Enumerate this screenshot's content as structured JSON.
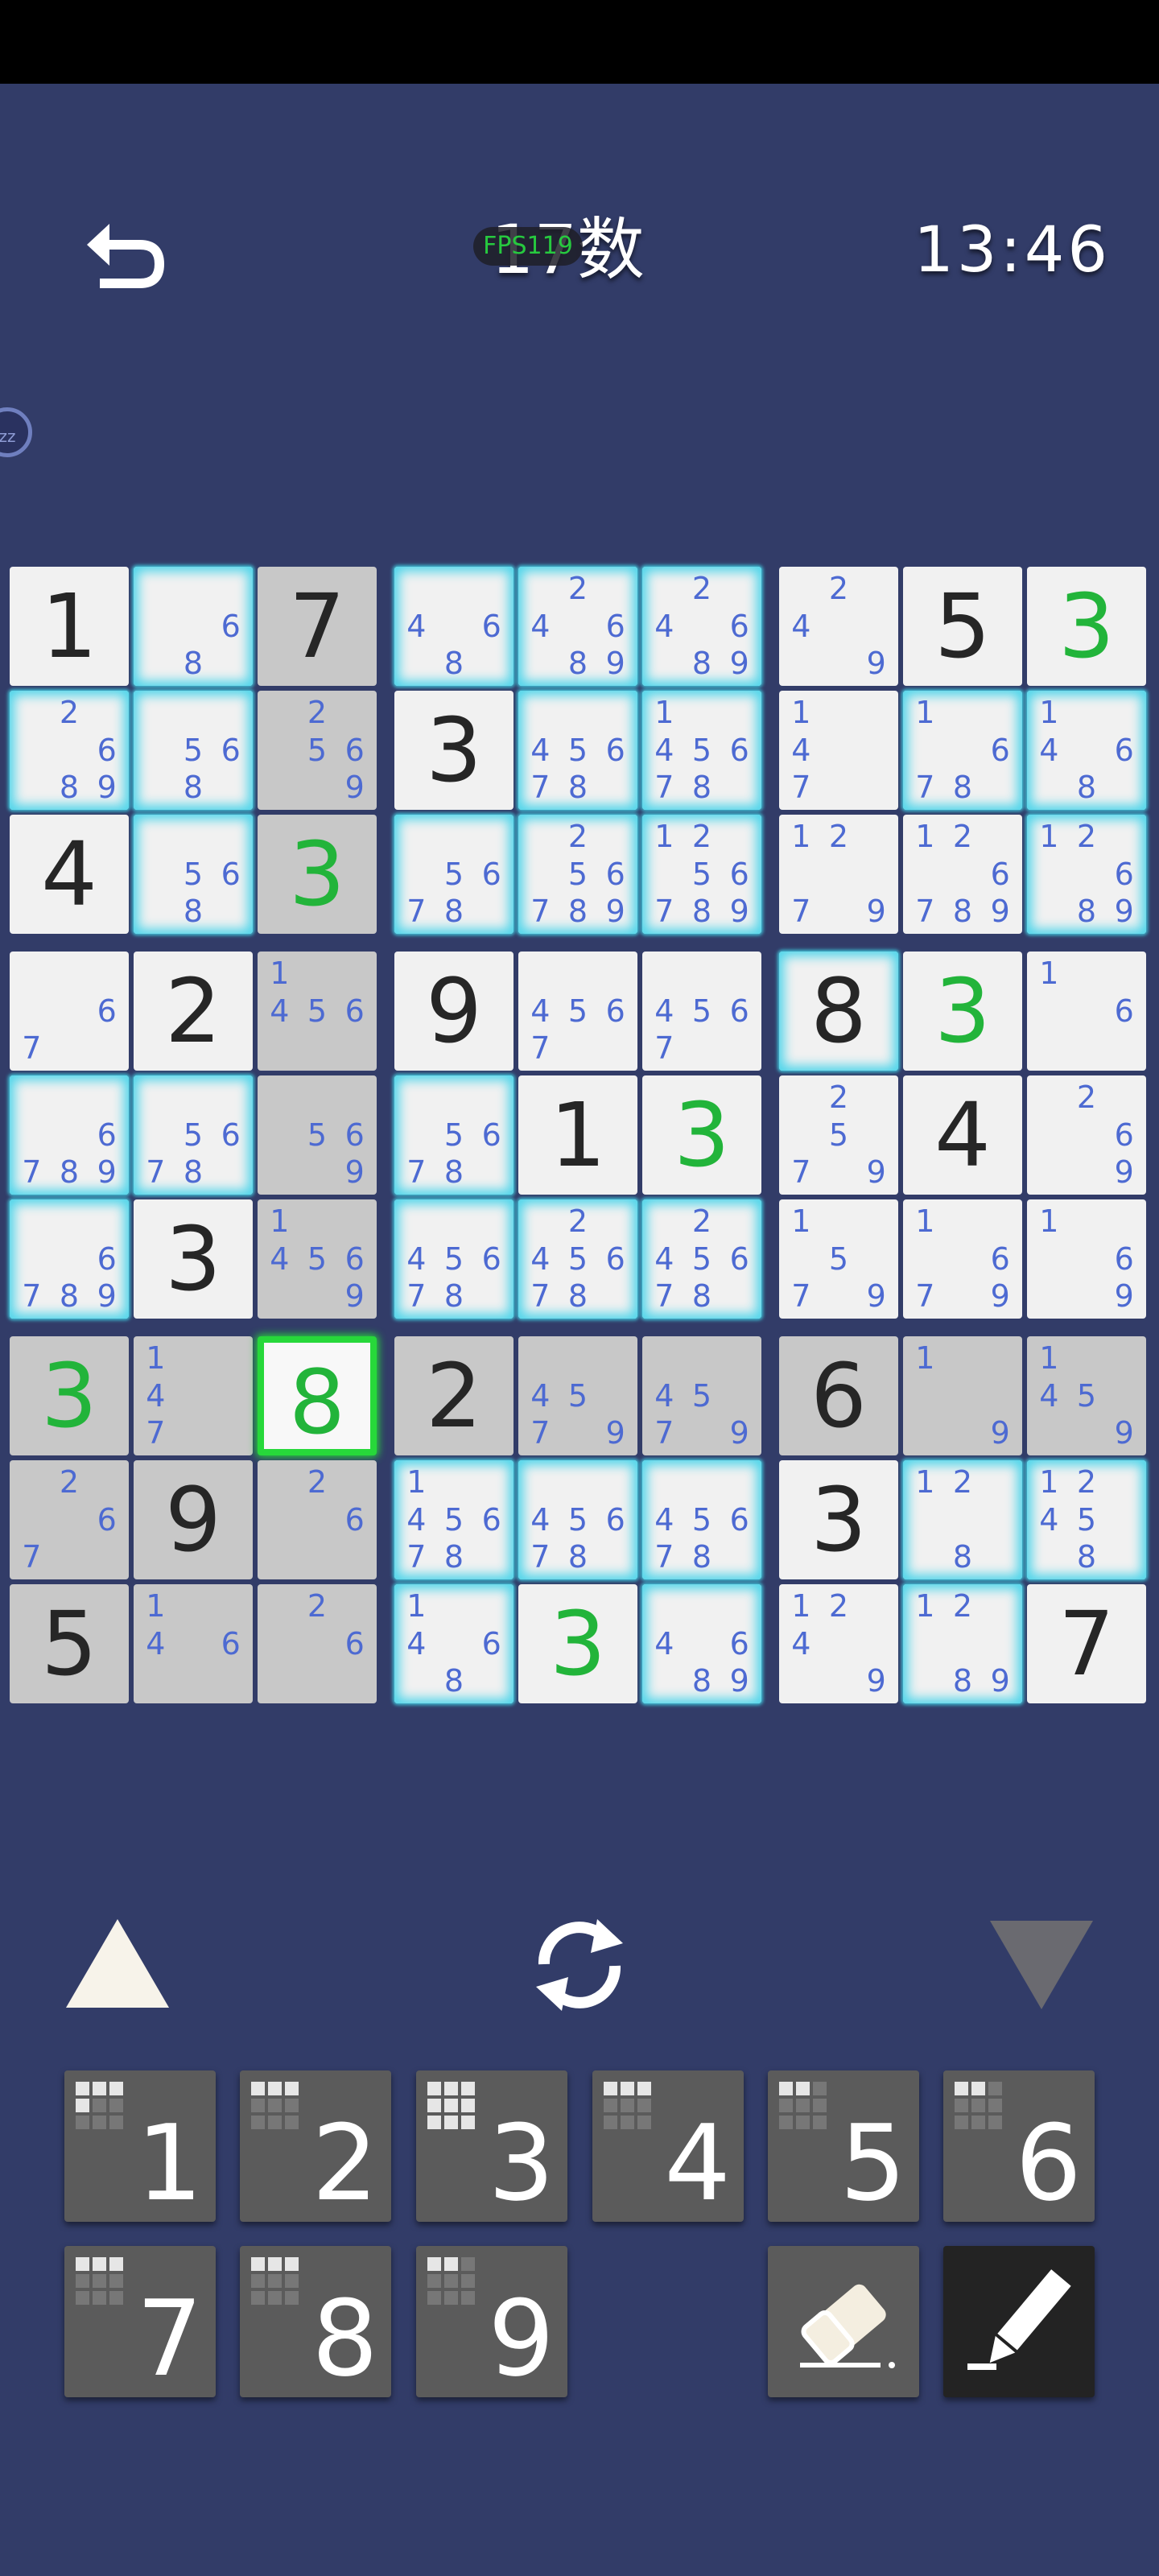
{
  "header": {
    "title": "17数",
    "fps_label": "FPS119",
    "timer": "13:46",
    "pause_label": "zz"
  },
  "colors": {
    "background": "#323c68",
    "given_digit": "#262626",
    "placed_digit": "#22b43a",
    "note_digit": "#4d6ad2",
    "highlight_glow": "#4fd5ea",
    "selected_border": "#27d83a"
  },
  "board": {
    "selected": [
      6,
      2
    ],
    "rows": [
      [
        {
          "v": "1",
          "k": "given",
          "s": "white"
        },
        {
          "n": [
            "6",
            "8"
          ],
          "s": "hl"
        },
        {
          "v": "7",
          "k": "given",
          "s": "gray"
        },
        {
          "n": [
            "4",
            "6",
            "8"
          ],
          "s": "hl"
        },
        {
          "n": [
            "2",
            "4",
            "6",
            "8",
            "9"
          ],
          "s": "hl"
        },
        {
          "n": [
            "2",
            "4",
            "6",
            "8",
            "9"
          ],
          "s": "hl"
        },
        {
          "n": [
            "2",
            "4",
            "9"
          ],
          "s": "white"
        },
        {
          "v": "5",
          "k": "given",
          "s": "white"
        },
        {
          "v": "3",
          "k": "placed",
          "s": "white"
        }
      ],
      [
        {
          "n": [
            "2",
            "6",
            "8",
            "9"
          ],
          "s": "hl"
        },
        {
          "n": [
            "5",
            "6",
            "8"
          ],
          "s": "hl"
        },
        {
          "n": [
            "2",
            "5",
            "6",
            "9"
          ],
          "s": "gray"
        },
        {
          "v": "3",
          "k": "given",
          "s": "white"
        },
        {
          "n": [
            "4",
            "5",
            "6",
            "7",
            "8"
          ],
          "s": "hl"
        },
        {
          "n": [
            "1",
            "4",
            "5",
            "6",
            "7",
            "8"
          ],
          "s": "hl"
        },
        {
          "n": [
            "1",
            "4",
            "7"
          ],
          "s": "white"
        },
        {
          "n": [
            "1",
            "6",
            "7",
            "8"
          ],
          "s": "hl"
        },
        {
          "n": [
            "1",
            "4",
            "6",
            "8"
          ],
          "s": "hl"
        }
      ],
      [
        {
          "v": "4",
          "k": "given",
          "s": "white"
        },
        {
          "n": [
            "5",
            "6",
            "8"
          ],
          "s": "hl"
        },
        {
          "v": "3",
          "k": "placed",
          "s": "gray"
        },
        {
          "n": [
            "5",
            "6",
            "7",
            "8"
          ],
          "s": "hl"
        },
        {
          "n": [
            "2",
            "5",
            "6",
            "7",
            "8",
            "9"
          ],
          "s": "hl"
        },
        {
          "n": [
            "1",
            "2",
            "5",
            "6",
            "7",
            "8",
            "9"
          ],
          "s": "hl"
        },
        {
          "n": [
            "1",
            "2",
            "7",
            "9"
          ],
          "s": "white"
        },
        {
          "n": [
            "1",
            "2",
            "6",
            "7",
            "8",
            "9"
          ],
          "s": "white"
        },
        {
          "n": [
            "1",
            "2",
            "6",
            "8",
            "9"
          ],
          "s": "hl"
        }
      ],
      [
        {
          "n": [
            "6",
            "7"
          ],
          "s": "white"
        },
        {
          "v": "2",
          "k": "given",
          "s": "white"
        },
        {
          "n": [
            "1",
            "4",
            "5",
            "6"
          ],
          "s": "gray"
        },
        {
          "v": "9",
          "k": "given",
          "s": "white"
        },
        {
          "n": [
            "4",
            "5",
            "6",
            "7"
          ],
          "s": "white"
        },
        {
          "n": [
            "4",
            "5",
            "6",
            "7"
          ],
          "s": "white"
        },
        {
          "v": "8",
          "k": "given",
          "s": "hl"
        },
        {
          "v": "3",
          "k": "placed",
          "s": "white"
        },
        {
          "n": [
            "1",
            "6"
          ],
          "s": "white"
        }
      ],
      [
        {
          "n": [
            "6",
            "7",
            "8",
            "9"
          ],
          "s": "hl"
        },
        {
          "n": [
            "5",
            "6",
            "7",
            "8"
          ],
          "s": "hl"
        },
        {
          "n": [
            "5",
            "6",
            "9"
          ],
          "s": "gray"
        },
        {
          "n": [
            "5",
            "6",
            "7",
            "8"
          ],
          "s": "hl"
        },
        {
          "v": "1",
          "k": "given",
          "s": "white"
        },
        {
          "v": "3",
          "k": "placed",
          "s": "white"
        },
        {
          "n": [
            "2",
            "5",
            "7",
            "9"
          ],
          "s": "white"
        },
        {
          "v": "4",
          "k": "given",
          "s": "white"
        },
        {
          "n": [
            "2",
            "6",
            "9"
          ],
          "s": "white"
        }
      ],
      [
        {
          "n": [
            "6",
            "7",
            "8",
            "9"
          ],
          "s": "hl"
        },
        {
          "v": "3",
          "k": "given",
          "s": "white"
        },
        {
          "n": [
            "1",
            "4",
            "5",
            "6",
            "9"
          ],
          "s": "gray"
        },
        {
          "n": [
            "4",
            "5",
            "6",
            "7",
            "8"
          ],
          "s": "hl"
        },
        {
          "n": [
            "2",
            "4",
            "5",
            "6",
            "7",
            "8"
          ],
          "s": "hl"
        },
        {
          "n": [
            "2",
            "4",
            "5",
            "6",
            "7",
            "8"
          ],
          "s": "hl"
        },
        {
          "n": [
            "1",
            "5",
            "7",
            "9"
          ],
          "s": "white"
        },
        {
          "n": [
            "1",
            "6",
            "7",
            "9"
          ],
          "s": "white"
        },
        {
          "n": [
            "1",
            "6",
            "9"
          ],
          "s": "white"
        }
      ],
      [
        {
          "v": "3",
          "k": "placed",
          "s": "gray"
        },
        {
          "n": [
            "1",
            "4",
            "7"
          ],
          "s": "gray"
        },
        {
          "v": "8",
          "k": "placed",
          "s": "sel"
        },
        {
          "v": "2",
          "k": "given",
          "s": "gray"
        },
        {
          "n": [
            "4",
            "5",
            "7",
            "9"
          ],
          "s": "gray"
        },
        {
          "n": [
            "4",
            "5",
            "7",
            "9"
          ],
          "s": "gray"
        },
        {
          "v": "6",
          "k": "given",
          "s": "gray"
        },
        {
          "n": [
            "1",
            "9"
          ],
          "s": "gray"
        },
        {
          "n": [
            "1",
            "4",
            "5",
            "9"
          ],
          "s": "gray"
        }
      ],
      [
        {
          "n": [
            "2",
            "6",
            "7"
          ],
          "s": "gray"
        },
        {
          "v": "9",
          "k": "given",
          "s": "gray"
        },
        {
          "n": [
            "2",
            "6"
          ],
          "s": "gray"
        },
        {
          "n": [
            "1",
            "4",
            "5",
            "6",
            "7",
            "8"
          ],
          "s": "hl"
        },
        {
          "n": [
            "4",
            "5",
            "6",
            "7",
            "8"
          ],
          "s": "hl"
        },
        {
          "n": [
            "4",
            "5",
            "6",
            "7",
            "8"
          ],
          "s": "hl"
        },
        {
          "v": "3",
          "k": "given",
          "s": "white"
        },
        {
          "n": [
            "1",
            "2",
            "8"
          ],
          "s": "hl"
        },
        {
          "n": [
            "1",
            "2",
            "4",
            "5",
            "8"
          ],
          "s": "hl"
        }
      ],
      [
        {
          "v": "5",
          "k": "given",
          "s": "gray"
        },
        {
          "n": [
            "1",
            "4",
            "6"
          ],
          "s": "gray"
        },
        {
          "n": [
            "2",
            "6"
          ],
          "s": "gray"
        },
        {
          "n": [
            "1",
            "4",
            "6",
            "8"
          ],
          "s": "hl"
        },
        {
          "v": "3",
          "k": "placed",
          "s": "white"
        },
        {
          "n": [
            "4",
            "6",
            "8",
            "9"
          ],
          "s": "hl"
        },
        {
          "n": [
            "1",
            "2",
            "4",
            "9"
          ],
          "s": "white"
        },
        {
          "n": [
            "1",
            "2",
            "8",
            "9"
          ],
          "s": "hl"
        },
        {
          "v": "7",
          "k": "given",
          "s": "white"
        }
      ]
    ]
  },
  "controls": {
    "up_icon": "triangle-up-icon",
    "refresh_icon": "refresh-icon",
    "down_icon": "triangle-down-icon"
  },
  "numpad": {
    "keys": [
      {
        "label": "1",
        "placed_count": 4
      },
      {
        "label": "2",
        "placed_count": 3
      },
      {
        "label": "3",
        "placed_count": 9
      },
      {
        "label": "4",
        "placed_count": 3
      },
      {
        "label": "5",
        "placed_count": 2
      },
      {
        "label": "6",
        "placed_count": 2
      },
      {
        "label": "7",
        "placed_count": 3
      },
      {
        "label": "8",
        "placed_count": 3
      },
      {
        "label": "9",
        "placed_count": 2
      }
    ],
    "eraser_icon": "eraser-icon",
    "pencil_icon": "pencil-icon",
    "pencil_active": true
  }
}
